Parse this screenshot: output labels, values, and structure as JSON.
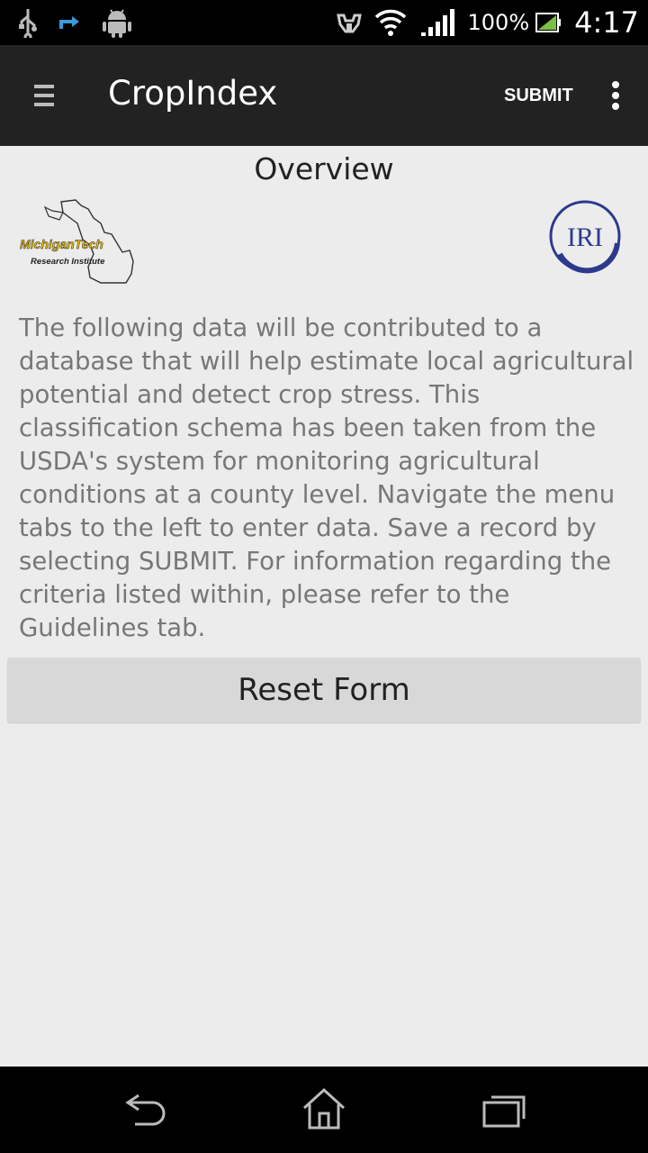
{
  "status_bar": {
    "battery_percent": "100%",
    "time": "4:17",
    "icons": [
      "usb-icon",
      "sync-icon",
      "android-icon",
      "headset-icon",
      "wifi-icon",
      "signal-icon",
      "battery-icon"
    ]
  },
  "app_bar": {
    "title": "CropIndex",
    "submit_label": "SUBMIT",
    "icons": [
      "menu-icon",
      "overflow-menu-icon"
    ]
  },
  "content": {
    "title": "Overview",
    "logos": {
      "mtri_line1": "MichiganTech",
      "mtri_line2": "Research Institute",
      "iri": "IRI"
    },
    "description": "The following data will be contributed to a database that will help estimate local agricultural potential and detect crop stress. This classification schema has been taken from the USDA's system for monitoring agricultural conditions at a county level. Navigate the menu tabs to the left to enter data. Save a record by selecting SUBMIT. For information regarding the criteria listed within, please refer to the Guidelines tab.",
    "reset_label": "Reset Form"
  },
  "nav_bar": {
    "icons": [
      "back-icon",
      "home-icon",
      "recent-apps-icon"
    ]
  },
  "colors": {
    "app_bar_bg": "#222222",
    "background": "#ececec",
    "button_bg": "#d8d8d8",
    "body_text": "#777777",
    "iri_blue": "#2c3a8c",
    "mtri_gold": "#f2c200"
  }
}
